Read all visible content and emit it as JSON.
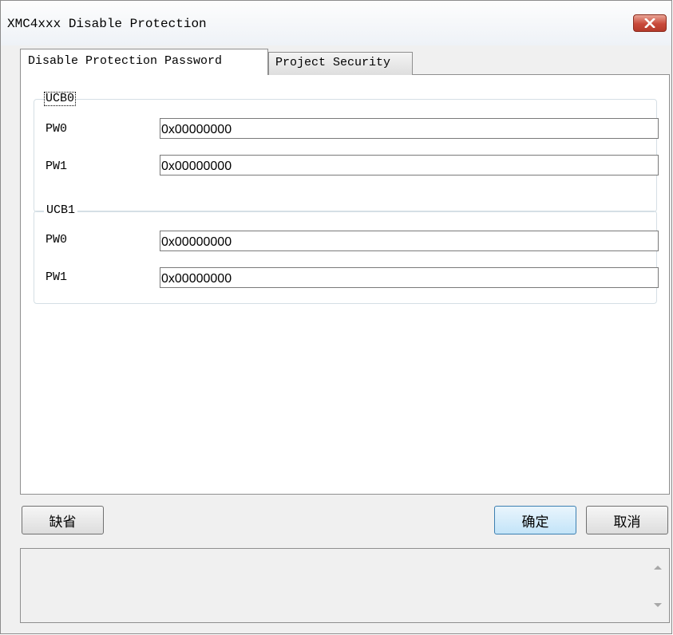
{
  "window": {
    "title": "XMC4xxx Disable Protection",
    "close_icon": "close-icon",
    "close_color": "#c8493a"
  },
  "tabs": [
    {
      "label": "Disable Protection Password",
      "active": true
    },
    {
      "label": "Project Security",
      "active": false
    }
  ],
  "groups": [
    {
      "legend": "UCB0",
      "fields": [
        {
          "label": "PW0",
          "value": "0x00000000"
        },
        {
          "label": "PW1",
          "value": "0x00000000"
        }
      ]
    },
    {
      "legend": "UCB1",
      "fields": [
        {
          "label": "PW0",
          "value": "0x00000000"
        },
        {
          "label": "PW1",
          "value": "0x00000000"
        }
      ]
    }
  ],
  "buttons": {
    "default_label": "缺省",
    "ok_label": "确定",
    "cancel_label": "取消"
  },
  "log": {
    "scroll_up_icon": "scroll-up-arrow-icon",
    "scroll_down_icon": "scroll-down-arrow-icon"
  }
}
